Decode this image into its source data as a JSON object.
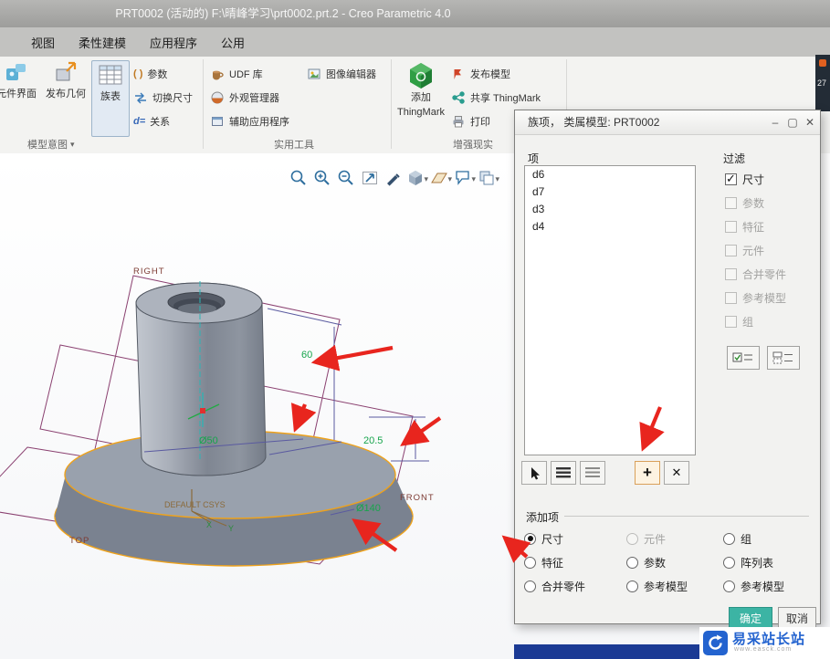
{
  "window": {
    "title": "PRT0002 (活动的) F:\\晴峰学习\\prt0002.prt.2 - Creo Parametric 4.0"
  },
  "side_panel": {
    "value": "27"
  },
  "tabs": [
    {
      "label": "视图"
    },
    {
      "label": "柔性建模"
    },
    {
      "label": "应用程序"
    },
    {
      "label": "公用"
    }
  ],
  "ribbon": {
    "groups": {
      "model_intent": {
        "label": "模型意图"
      },
      "utilities": {
        "label": "实用工具"
      },
      "augmented_reality": {
        "label": "增强现实"
      }
    },
    "buttons": {
      "component_interface": "元件界面",
      "publish_geometry": "发布几何",
      "family_table": "族表",
      "parameters": "参数",
      "parameters_glyph": "( )",
      "switch_dimensions": "切换尺寸",
      "relations": "关系",
      "relations_glyph": "d=",
      "udf_library": "UDF 库",
      "appearance_manager": "外观管理器",
      "auxiliary_applications": "辅助应用程序",
      "image_editor": "图像编辑器",
      "add_thingmark_line1": "添加",
      "add_thingmark_line2": "ThingMark",
      "publish_model": "发布模型",
      "share_thingmark": "共享 ThingMark",
      "print": "打印"
    }
  },
  "canvas": {
    "plane_labels": {
      "right": "RIGHT",
      "front": "FRONT",
      "top": "TOP",
      "csys": "DEFAULT CSYS",
      "axis_x": "X",
      "axis_y": "Y"
    },
    "dimensions": {
      "height": "60",
      "thickness": "20.5",
      "base_diameter": "Ø140",
      "boss_diameter": "Ø50"
    }
  },
  "dialog": {
    "title": "族项， 类属模型: PRT0002",
    "window_buttons": {
      "minimize": "–",
      "maximize": "▢",
      "close": "✕"
    },
    "items_section": {
      "label": "项",
      "items": [
        {
          "name": "d6"
        },
        {
          "name": "d7"
        },
        {
          "name": "d3"
        },
        {
          "name": "d4"
        }
      ]
    },
    "toolbar": {
      "add": "+",
      "remove": "✕"
    },
    "filter_section": {
      "label": "过滤",
      "options": [
        {
          "label": "尺寸",
          "checked": true,
          "disabled": false
        },
        {
          "label": "参数",
          "checked": false,
          "disabled": true
        },
        {
          "label": "特征",
          "checked": false,
          "disabled": true
        },
        {
          "label": "元件",
          "checked": false,
          "disabled": true
        },
        {
          "label": "合并零件",
          "checked": false,
          "disabled": true
        },
        {
          "label": "参考模型",
          "checked": false,
          "disabled": true
        },
        {
          "label": "组",
          "checked": false,
          "disabled": true
        }
      ]
    },
    "add_section": {
      "label": "添加项",
      "options": [
        {
          "label": "尺寸",
          "selected": true,
          "disabled": false
        },
        {
          "label": "元件",
          "selected": false,
          "disabled": true
        },
        {
          "label": "组",
          "selected": false,
          "disabled": false
        },
        {
          "label": "特征",
          "selected": false,
          "disabled": false
        },
        {
          "label": "参数",
          "selected": false,
          "disabled": false
        },
        {
          "label": "阵列表",
          "selected": false,
          "disabled": false
        },
        {
          "label": "合并零件",
          "selected": false,
          "disabled": false
        },
        {
          "label": "参考模型",
          "selected": false,
          "disabled": false
        },
        {
          "label": "参考模型",
          "selected": false,
          "disabled": false
        }
      ]
    },
    "footer": {
      "ok": "确定",
      "cancel": "取消"
    }
  },
  "watermark": {
    "title": "易采站长站",
    "subtitle": "www.easck.com"
  }
}
